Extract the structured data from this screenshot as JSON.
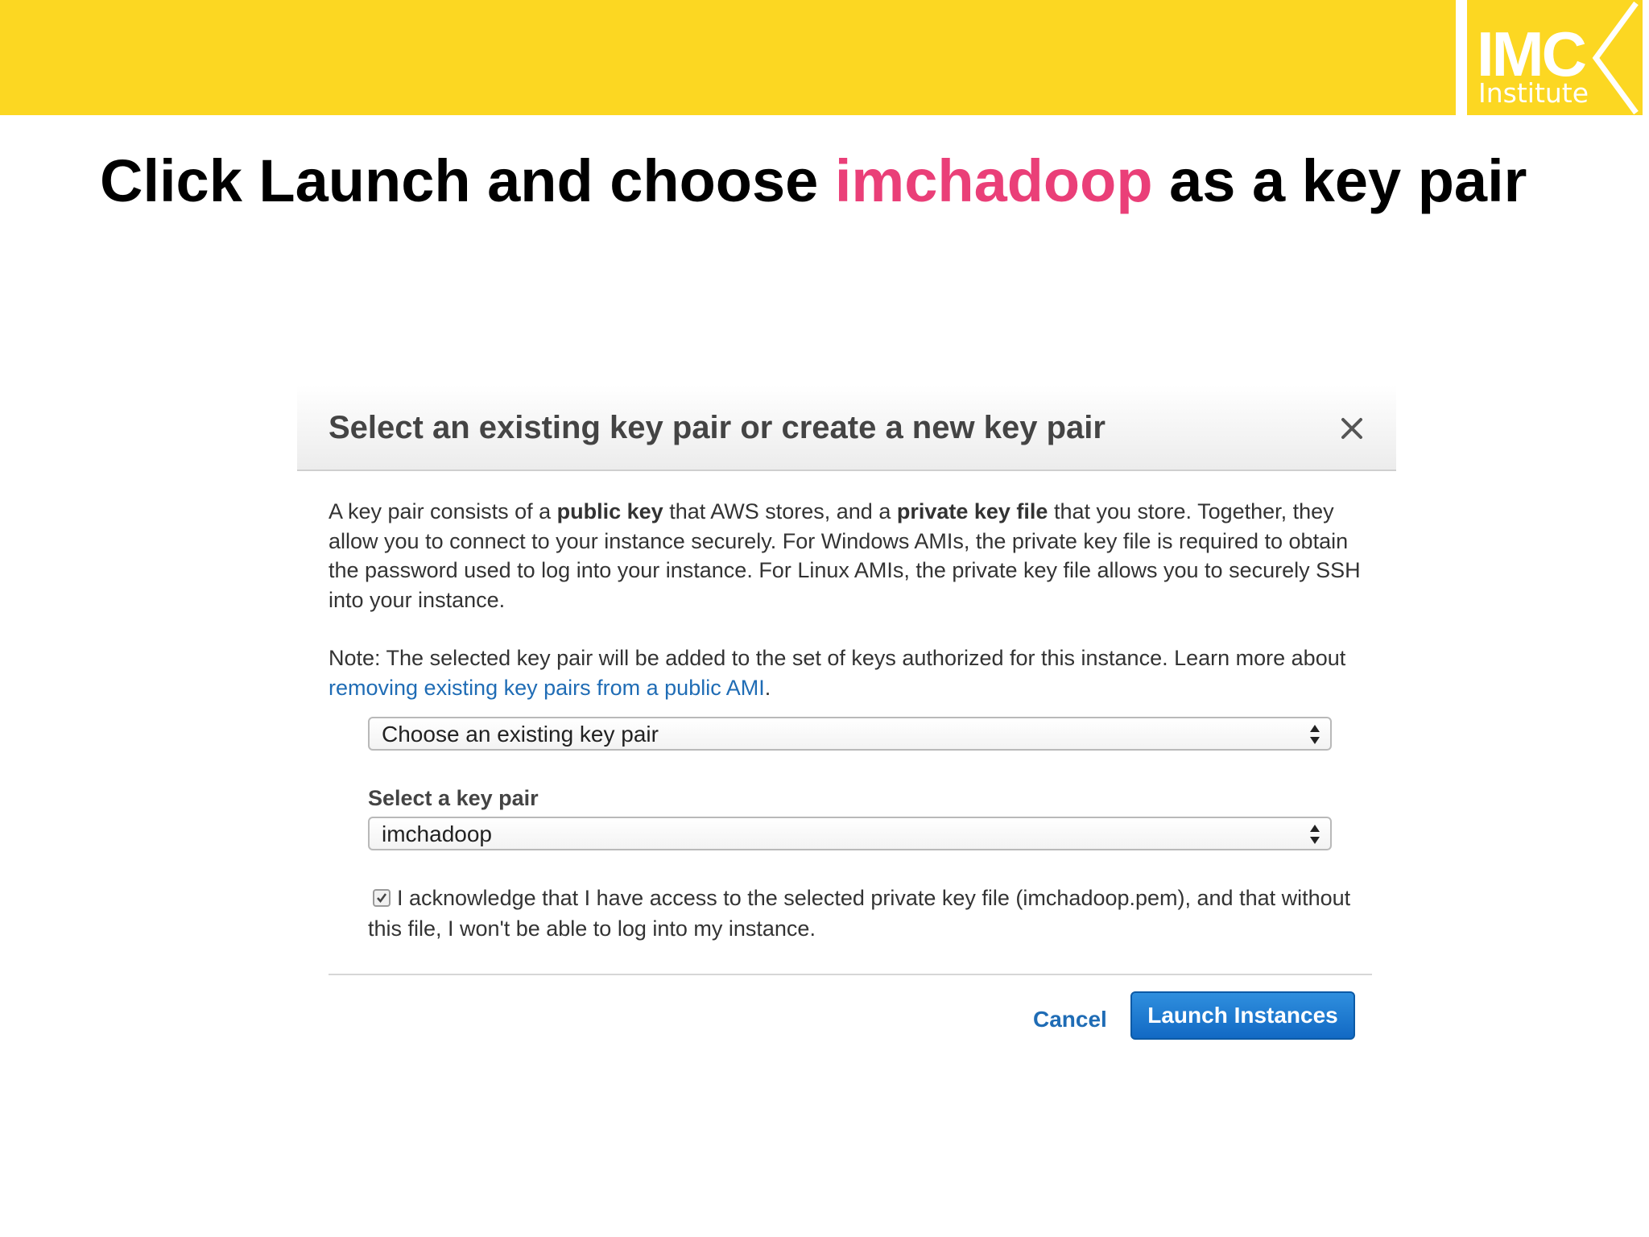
{
  "slide": {
    "title_before": "Click Launch and choose ",
    "title_highlight": "imchadoop",
    "title_after": " as a key pair",
    "highlight_color": "#EA3F78",
    "banner_color": "#FCD722",
    "logo": {
      "line1": "IMC",
      "line2": "Institute"
    }
  },
  "dialog": {
    "title": "Select an existing key pair or create a new key pair",
    "close_icon": "close-icon",
    "para1": {
      "t1": "A key pair consists of a ",
      "b1": "public key",
      "t2": " that AWS stores, and a ",
      "b2": "private key file",
      "t3": " that you store. Together, they allow you to connect to your instance securely. For Windows AMIs, the private key file is required to obtain the password used to log into your instance. For Linux AMIs, the private key file allows you to securely SSH into your instance."
    },
    "para2": {
      "t1": "Note: The selected key pair will be added to the set of keys authorized for this instance. Learn more about ",
      "link": "removing existing key pairs from a public AMI",
      "t2": "."
    },
    "keypair_mode_select": {
      "value": "Choose an existing key pair"
    },
    "keypair_select": {
      "label": "Select a key pair",
      "value": "imchadoop"
    },
    "acknowledge": {
      "checked": true,
      "text": "I acknowledge that I have access to the selected private key file (imchadoop.pem), and that without this file, I won't be able to log into my instance."
    },
    "cancel_label": "Cancel",
    "launch_label": "Launch Instances",
    "link_color": "#1F6CB5",
    "primary_color": "#1A73CC"
  }
}
